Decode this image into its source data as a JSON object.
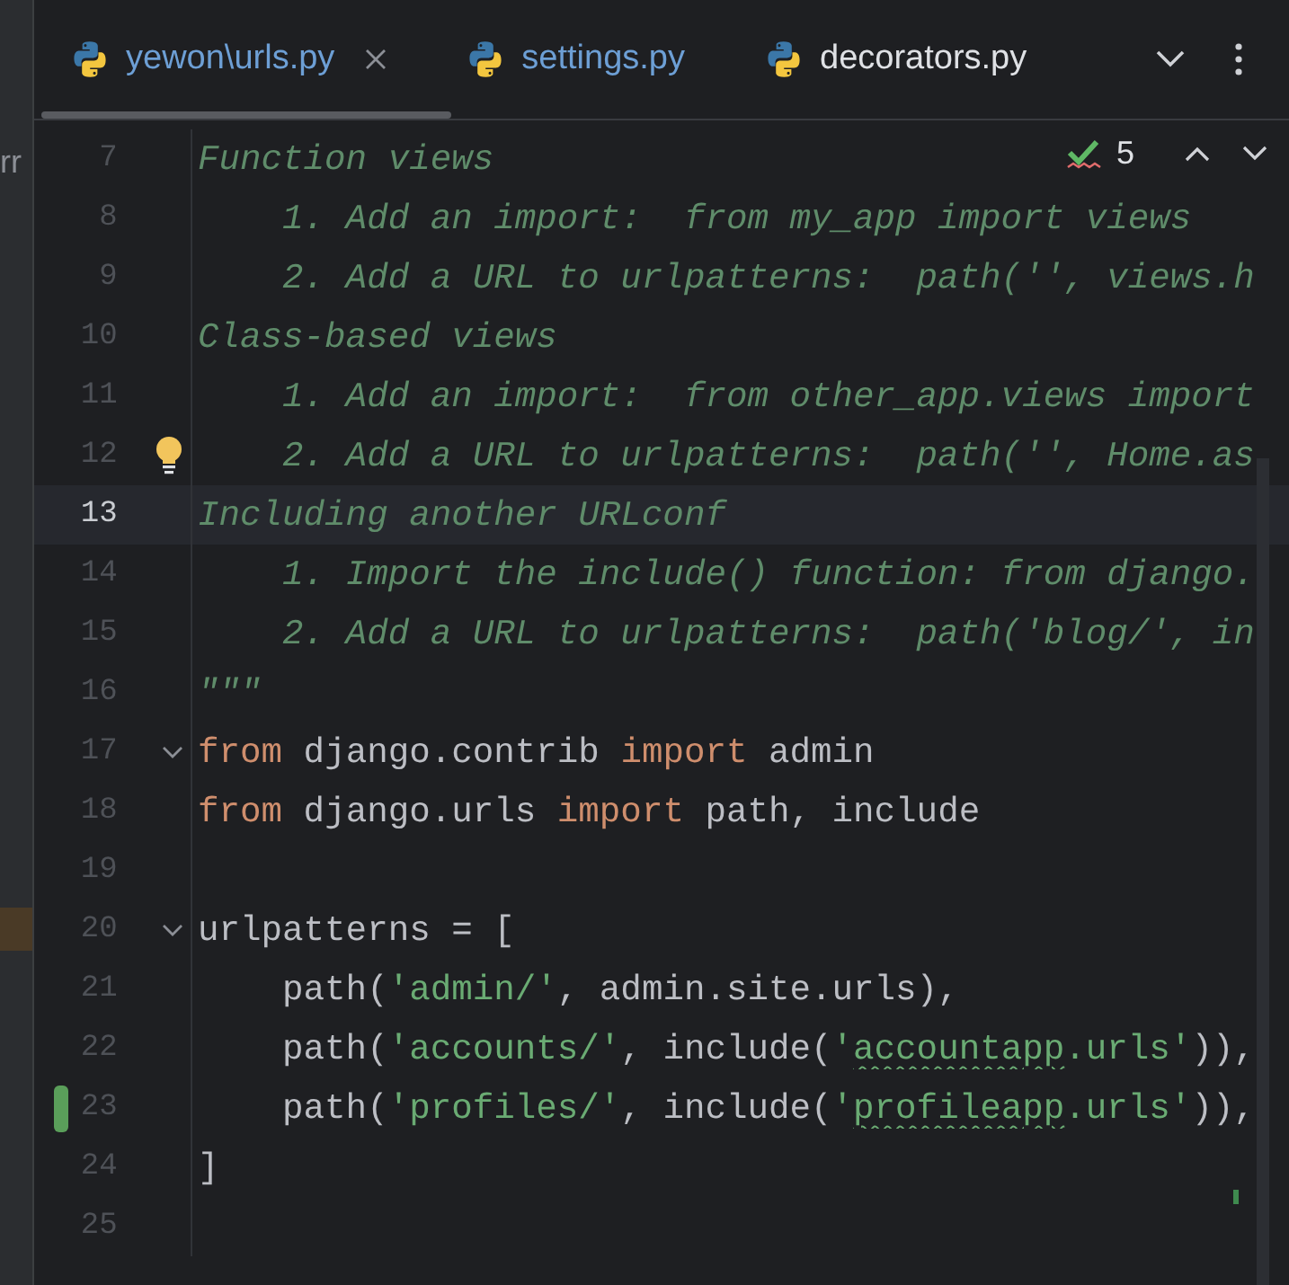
{
  "side_panel": {
    "text": "rr"
  },
  "tabs": [
    {
      "label": "yewon\\urls.py",
      "modified": true,
      "closable": true
    },
    {
      "label": "settings.py",
      "modified": true,
      "closable": false
    },
    {
      "label": "decorators.py",
      "modified": false,
      "closable": false
    }
  ],
  "inspections": {
    "count": "5"
  },
  "lines": [
    {
      "number": "7",
      "current": false,
      "fold": false,
      "changed": false,
      "bulb": false,
      "tokens": [
        {
          "kind": "comment",
          "text": "Function views"
        }
      ]
    },
    {
      "number": "8",
      "current": false,
      "fold": false,
      "changed": false,
      "bulb": false,
      "tokens": [
        {
          "kind": "comment",
          "text": "    1. Add an import:  from my_app import views"
        }
      ]
    },
    {
      "number": "9",
      "current": false,
      "fold": false,
      "changed": false,
      "bulb": false,
      "tokens": [
        {
          "kind": "comment",
          "text": "    2. Add a URL to urlpatterns:  path('', views.h"
        }
      ]
    },
    {
      "number": "10",
      "current": false,
      "fold": false,
      "changed": false,
      "bulb": false,
      "tokens": [
        {
          "kind": "comment",
          "text": "Class-based views"
        }
      ]
    },
    {
      "number": "11",
      "current": false,
      "fold": false,
      "changed": false,
      "bulb": false,
      "tokens": [
        {
          "kind": "comment",
          "text": "    1. Add an import:  from other_app.views import"
        }
      ]
    },
    {
      "number": "12",
      "current": false,
      "fold": false,
      "changed": false,
      "bulb": true,
      "tokens": [
        {
          "kind": "comment",
          "text": "    2. Add a URL to urlpatterns:  path('', Home.as"
        }
      ]
    },
    {
      "number": "13",
      "current": true,
      "fold": false,
      "changed": false,
      "bulb": false,
      "tokens": [
        {
          "kind": "comment",
          "text": "Including another URLconf"
        }
      ]
    },
    {
      "number": "14",
      "current": false,
      "fold": false,
      "changed": false,
      "bulb": false,
      "tokens": [
        {
          "kind": "comment",
          "text": "    1. Import the include() function: from django."
        }
      ]
    },
    {
      "number": "15",
      "current": false,
      "fold": false,
      "changed": false,
      "bulb": false,
      "tokens": [
        {
          "kind": "comment",
          "text": "    2. Add a URL to urlpatterns:  path('blog/', in"
        }
      ]
    },
    {
      "number": "16",
      "current": false,
      "fold": false,
      "changed": false,
      "bulb": false,
      "tokens": [
        {
          "kind": "comment",
          "text": "\"\"\""
        }
      ]
    },
    {
      "number": "17",
      "current": false,
      "fold": true,
      "changed": false,
      "bulb": false,
      "tokens": [
        {
          "kind": "keyword",
          "text": "from"
        },
        {
          "kind": "plain",
          "text": " django.contrib "
        },
        {
          "kind": "keyword",
          "text": "import"
        },
        {
          "kind": "plain",
          "text": " admin"
        }
      ]
    },
    {
      "number": "18",
      "current": false,
      "fold": false,
      "changed": false,
      "bulb": false,
      "tokens": [
        {
          "kind": "keyword",
          "text": "from"
        },
        {
          "kind": "plain",
          "text": " django.urls "
        },
        {
          "kind": "keyword",
          "text": "import"
        },
        {
          "kind": "plain",
          "text": " path, include"
        }
      ]
    },
    {
      "number": "19",
      "current": false,
      "fold": false,
      "changed": false,
      "bulb": false
    },
    {
      "number": "20",
      "current": false,
      "fold": true,
      "changed": false,
      "bulb": false,
      "tokens": [
        {
          "kind": "plain",
          "text": "urlpatterns = ["
        }
      ]
    },
    {
      "number": "21",
      "current": false,
      "fold": false,
      "changed": false,
      "bulb": false,
      "tokens": [
        {
          "kind": "plain",
          "text": "    path("
        },
        {
          "kind": "string",
          "text": "'admin/'"
        },
        {
          "kind": "plain",
          "text": ", admin.site.urls),"
        }
      ]
    },
    {
      "number": "22",
      "current": false,
      "fold": false,
      "changed": false,
      "bulb": false,
      "tokens": [
        {
          "kind": "plain",
          "text": "    path("
        },
        {
          "kind": "string",
          "text": "'accounts/'"
        },
        {
          "kind": "plain",
          "text": ", include("
        },
        {
          "kind": "string",
          "text": "'"
        },
        {
          "kind": "typo",
          "text": "accountapp"
        },
        {
          "kind": "string",
          "text": ".urls'"
        },
        {
          "kind": "plain",
          "text": ")),"
        }
      ]
    },
    {
      "number": "23",
      "current": false,
      "fold": false,
      "changed": true,
      "bulb": false,
      "tokens": [
        {
          "kind": "plain",
          "text": "    path("
        },
        {
          "kind": "string",
          "text": "'profiles/'"
        },
        {
          "kind": "plain",
          "text": ", include("
        },
        {
          "kind": "string",
          "text": "'"
        },
        {
          "kind": "typo",
          "text": "profileapp"
        },
        {
          "kind": "string",
          "text": ".urls'"
        },
        {
          "kind": "plain",
          "text": ")),"
        }
      ]
    },
    {
      "number": "24",
      "current": false,
      "fold": false,
      "changed": false,
      "bulb": false,
      "tokens": [
        {
          "kind": "plain",
          "text": "]"
        }
      ]
    },
    {
      "number": "25",
      "current": false,
      "fold": false,
      "changed": false,
      "bulb": false
    }
  ]
}
